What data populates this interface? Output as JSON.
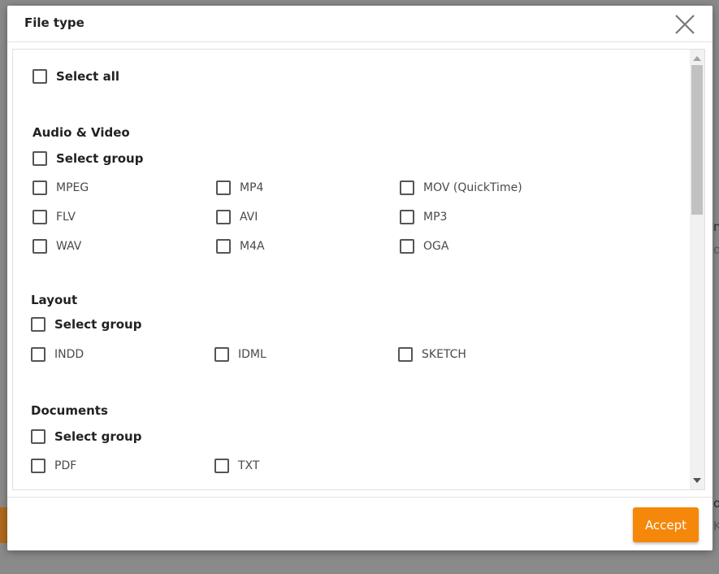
{
  "dialog": {
    "title": "File type",
    "select_all_label": "Select all",
    "accept_label": "Accept"
  },
  "groups": [
    {
      "title": "Audio & Video",
      "select_group_label": "Select group",
      "options": [
        "MPEG",
        "MP4",
        "MOV (QuickTime)",
        "FLV",
        "AVI",
        "MP3",
        "WAV",
        "M4A",
        "OGA"
      ]
    },
    {
      "title": "Layout",
      "select_group_label": "Select group",
      "options": [
        "INDD",
        "IDML",
        "SKETCH"
      ]
    },
    {
      "title": "Documents",
      "select_group_label": "Select group",
      "options": [
        "PDF",
        "TXT"
      ]
    }
  ],
  "colors": {
    "accent": "#f5880a",
    "overlay": "#8a8a8a"
  }
}
